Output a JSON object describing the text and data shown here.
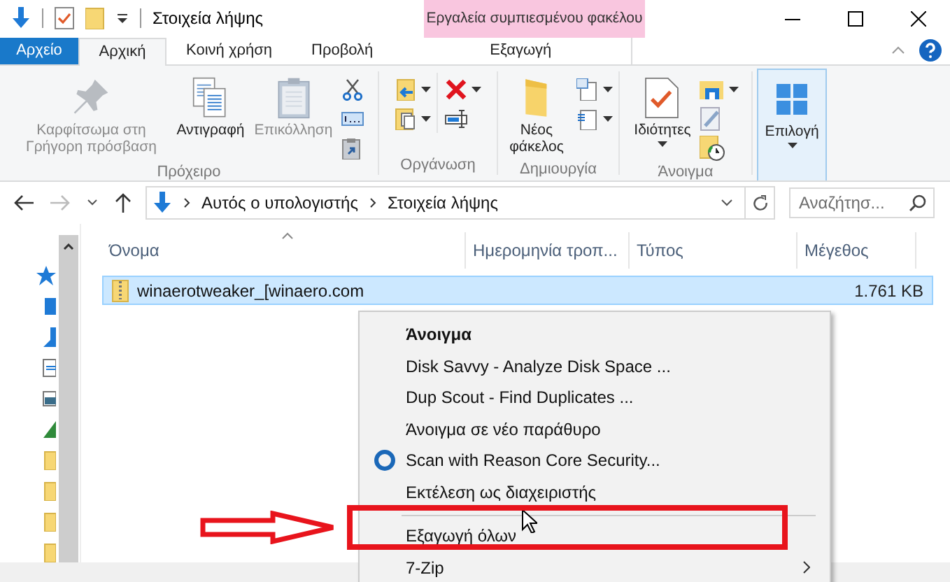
{
  "title_bar": {
    "title": "Στοιχεία λήψης",
    "contextual_group": "Εργαλεία συμπιεσμένου φακέλου"
  },
  "tabs": [
    {
      "label": "Αρχείο",
      "kind": "file",
      "selected": false
    },
    {
      "label": "Αρχική",
      "kind": "normal",
      "selected": true
    },
    {
      "label": "Κοινή χρήση",
      "kind": "normal",
      "selected": false
    },
    {
      "label": "Προβολή",
      "kind": "normal",
      "selected": false
    },
    {
      "label": "Εξαγωγή",
      "kind": "contextual",
      "selected": false
    }
  ],
  "ribbon": [
    {
      "label": "Πρόχειρο",
      "items": [
        {
          "kind": "pin",
          "label": "Καρφίτσωμα στη Γρήγορη πρόσβαση",
          "disabled": true
        },
        {
          "kind": "copy",
          "label": "Αντιγραφή",
          "disabled": false
        },
        {
          "kind": "paste",
          "label": "Επικόλληση",
          "disabled": true
        },
        {
          "kind": "stack",
          "buttons": [
            {
              "kind": "scissors",
              "dropdown": false
            },
            {
              "kind": "path",
              "dropdown": false
            },
            {
              "kind": "shortcut",
              "dropdown": false
            }
          ]
        }
      ]
    },
    {
      "label": "Οργάνωση",
      "items": [
        {
          "kind": "stack",
          "buttons": [
            {
              "kind": "moveto",
              "dropdown": true
            },
            {
              "kind": "copyto",
              "dropdown": true
            }
          ]
        },
        {
          "kind": "stack",
          "buttons": [
            {
              "kind": "delete",
              "dropdown": true
            },
            {
              "kind": "rename",
              "dropdown": false
            }
          ]
        }
      ]
    },
    {
      "label": "Δημιουργία",
      "items": [
        {
          "kind": "newfolder",
          "label": "Νέος φάκελος",
          "disabled": false
        },
        {
          "kind": "stack",
          "buttons": [
            {
              "kind": "newitem",
              "dropdown": true
            },
            {
              "kind": "easyaccess",
              "dropdown": true
            }
          ]
        }
      ]
    },
    {
      "label": "Άνοιγμα",
      "items": [
        {
          "kind": "properties",
          "label": "Ιδιότητες",
          "disabled": false,
          "dropdown": true
        },
        {
          "kind": "stack",
          "buttons": [
            {
              "kind": "open",
              "dropdown": true
            },
            {
              "kind": "edit",
              "dropdown": false
            },
            {
              "kind": "history",
              "dropdown": false
            }
          ]
        }
      ]
    },
    {
      "items": [
        {
          "kind": "select",
          "label": "Επιλογή",
          "disabled": false,
          "dropdown": true,
          "selected": true
        }
      ]
    }
  ],
  "address": {
    "path": [
      "Αυτός ο υπολογιστής",
      "Στοιχεία λήψης"
    ],
    "search_placeholder": "Αναζήτησ..."
  },
  "table": {
    "columns": [
      "Όνομα",
      "Ημερομηνία τροπ...",
      "Τύπος",
      "Μέγεθος"
    ],
    "rows": [
      {
        "name": "winaerotweaker_[winaero.com",
        "size": "1.761 KB",
        "selected": true
      }
    ]
  },
  "context_menu": [
    {
      "kind": "default",
      "label": "Άνοιγμα"
    },
    {
      "kind": "plain",
      "label": "Disk Savvy - Analyze Disk Space ..."
    },
    {
      "kind": "plain",
      "label": "Dup Scout - Find Duplicates ..."
    },
    {
      "kind": "plain",
      "label": "Άνοιγμα σε νέο παράθυρο"
    },
    {
      "kind": "icon",
      "label": "Scan with Reason Core Security..."
    },
    {
      "kind": "plain",
      "label": "Εκτέλεση ως διαχειριστής"
    },
    {
      "kind": "separator"
    },
    {
      "kind": "plain",
      "label": "Εξαγωγή όλων"
    },
    {
      "kind": "submenu",
      "label": "7-Zip"
    }
  ]
}
